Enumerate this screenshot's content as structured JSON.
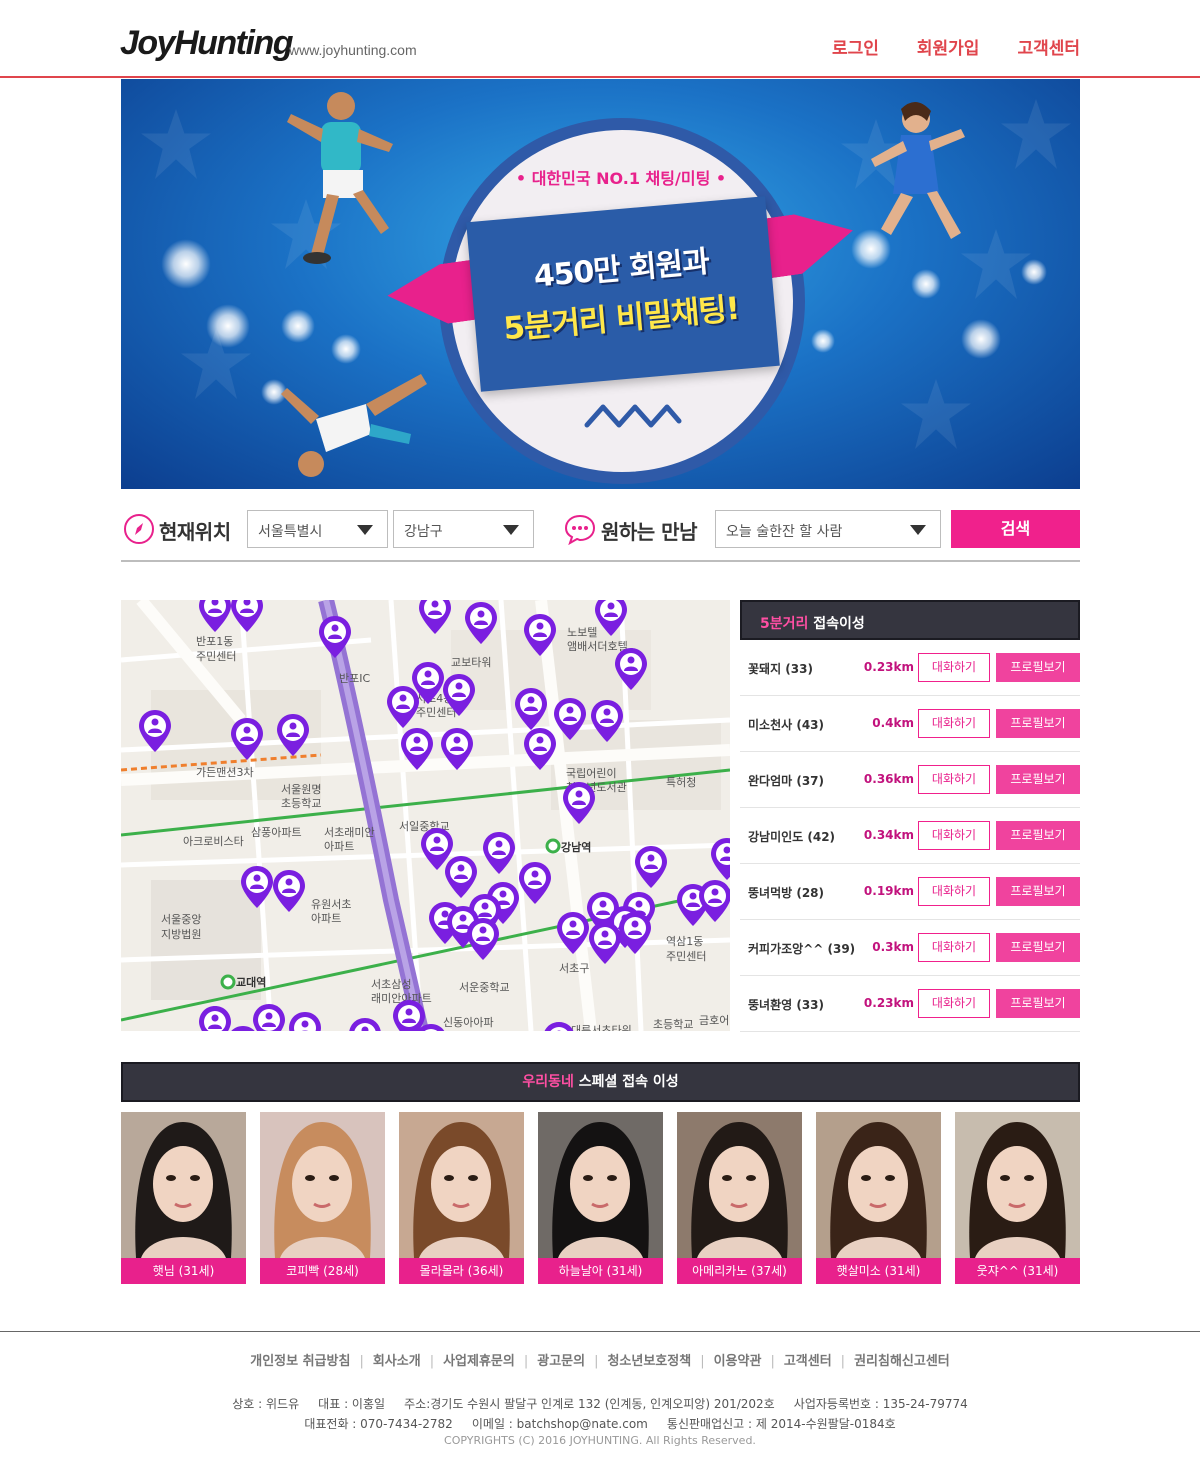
{
  "header": {
    "logo_text": "JoyHunting",
    "site_url": "www.joyhunting.com",
    "nav": [
      "로그인",
      "회원가입",
      "고객센터"
    ]
  },
  "banner": {
    "tagline": "• 대한민국 NO.1 채팅/미팅 •",
    "headline1": "450만 회원과",
    "headline2": "5분거리 비밀채팅!"
  },
  "search": {
    "location_label": "현재위치",
    "city": "서울특별시",
    "district": "강남구",
    "meet_label": "원하는 만남",
    "meet_type": "오늘 술한잔 할 사람",
    "button": "검색"
  },
  "map": {
    "labels": [
      "반포1동 주민센터",
      "반포IC",
      "교보타워",
      "노보텔 앰배서더호텔",
      "서초4동 주민센터",
      "가든맨션3차",
      "서울원명 초등학교",
      "국립어린이 청소년도서관",
      "특허청",
      "아크로비스타",
      "삼풍아파트",
      "서초래미안 아파트",
      "서일중학교",
      "강남역",
      "유원서초 아파트",
      "서울중앙 지방법원",
      "교대역",
      "서초삼성 래미안아파트",
      "서운중학교",
      "신동아아파트",
      "역삼1동 주민센터",
      "서초구",
      "대륭서초타워",
      "금호어",
      "역삼 초등학교"
    ]
  },
  "nearby": {
    "title_accent": "5분거리",
    "title_rest": " 접속이성",
    "chat_label": "대화하기",
    "profile_label": "프로필보기",
    "rows": [
      {
        "name": "꽃돼지 (33)",
        "distance": "0.23km"
      },
      {
        "name": "미소천사 (43)",
        "distance": "0.4km"
      },
      {
        "name": "완다엄마 (37)",
        "distance": "0.36km"
      },
      {
        "name": "강남미인도 (42)",
        "distance": "0.34km"
      },
      {
        "name": "뚱녀먹방 (28)",
        "distance": "0.19km"
      },
      {
        "name": "커피가조앙^^ (39)",
        "distance": "0.3km"
      },
      {
        "name": "뚱녀환영 (33)",
        "distance": "0.23km"
      }
    ]
  },
  "special": {
    "title_accent": "우리동네",
    "title_rest": " 스페셜 접속 이성",
    "members": [
      {
        "name": "햇님 (31세)"
      },
      {
        "name": "코피빡 (28세)"
      },
      {
        "name": "몰라몰라 (36세)"
      },
      {
        "name": "하늘날아 (31세)"
      },
      {
        "name": "아메리카노 (37세)"
      },
      {
        "name": "햇살미소 (31세)"
      },
      {
        "name": "웃쟈^^ (31세)"
      }
    ]
  },
  "footer": {
    "links": [
      "개인정보 취급방침",
      "회사소개",
      "사업제휴문의",
      "광고문의",
      "청소년보호정책",
      "이용약관",
      "고객센터",
      "권리침해신고센터"
    ],
    "info_line1": "상호 : 위드유     대표 : 이홍일     주소:경기도 수원시 팔달구 인계로 132 (인계동, 인계오피앙) 201/202호     사업자등록번호 : 135-24-79774",
    "info_line2": "대표전화 : 070-7434-2782     이메일 : batchshop@nate.com     통신판매업신고 : 제 2014-수원팔달-0184호",
    "copyright": "COPYRIGHTS (C) 2016 JOYHUNTING. All Rights Reserved."
  },
  "colors": {
    "brand_red": "#e0454c",
    "pink": "#e8218c",
    "pin_purple": "#7a1fe0",
    "dark_bar": "#35353f"
  }
}
